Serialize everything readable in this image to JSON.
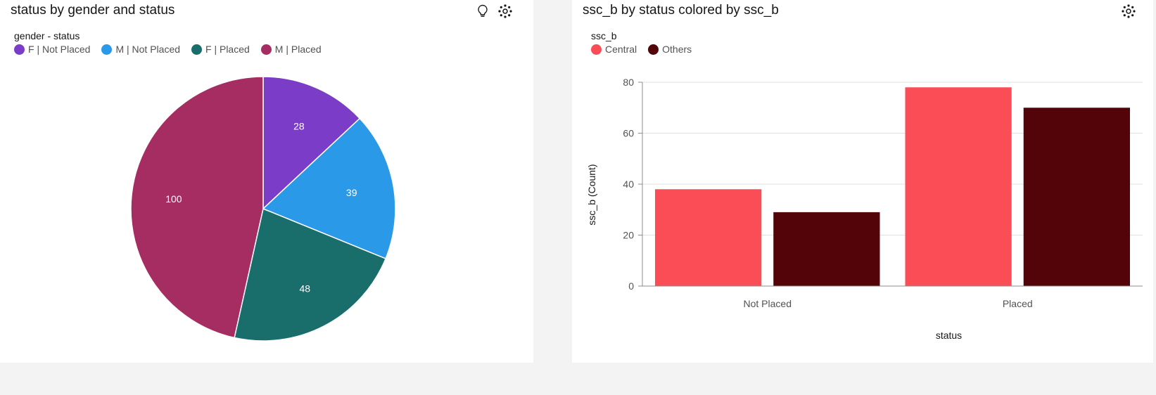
{
  "left_card": {
    "title": "status by gender and status",
    "icons": [
      "lightbulb-icon",
      "settings-icon"
    ],
    "legend_title": "gender - status"
  },
  "right_card": {
    "title": "ssc_b by status colored by ssc_b",
    "icons": [
      "settings-icon"
    ],
    "legend_title": "ssc_b"
  },
  "chart_data": [
    {
      "type": "pie",
      "title": "status by gender and status",
      "legend_title": "gender - status",
      "legend_placement": "top-left",
      "slices": [
        {
          "label": "F | Not Placed",
          "value": 28,
          "color": "#7b3dc8"
        },
        {
          "label": "M | Not Placed",
          "value": 39,
          "color": "#2a9ae8"
        },
        {
          "label": "F | Placed",
          "value": 48,
          "color": "#196d6b"
        },
        {
          "label": "M | Placed",
          "value": 100,
          "color": "#a62d62"
        }
      ]
    },
    {
      "type": "bar",
      "title": "ssc_b by status colored by ssc_b",
      "xlabel": "status",
      "ylabel": "ssc_b (Count)",
      "legend_title": "ssc_b",
      "legend_placement": "top-left",
      "categories": [
        "Not Placed",
        "Placed"
      ],
      "series": [
        {
          "name": "Central",
          "values": [
            38,
            78
          ],
          "color": "#fa4d56"
        },
        {
          "name": "Others",
          "values": [
            29,
            70
          ],
          "color": "#520408"
        }
      ],
      "yticks": [
        "0",
        "20",
        "40",
        "60",
        "80"
      ],
      "ylim": [
        0,
        80
      ],
      "grid": true
    }
  ]
}
